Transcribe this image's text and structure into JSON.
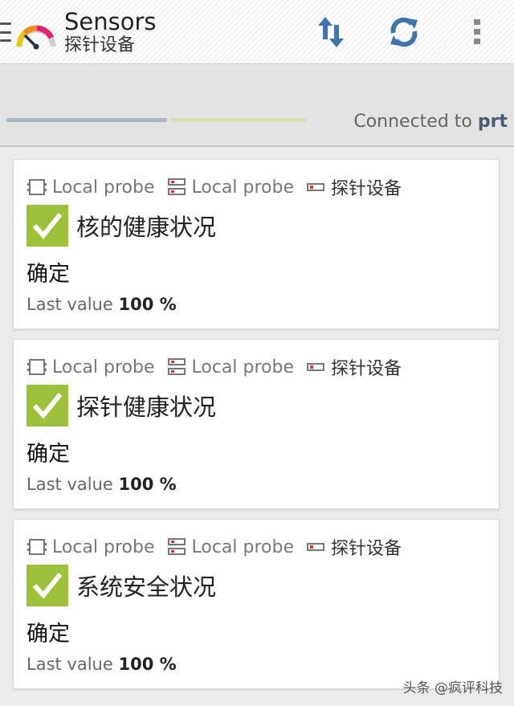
{
  "app": {
    "title": "Sensors",
    "subtitle": "探针设备"
  },
  "toolbar": {
    "icons": [
      "menu-icon",
      "gauge-logo",
      "sort-arrows-icon",
      "refresh-icon",
      "overflow-menu-icon"
    ]
  },
  "status": {
    "connected_label": "Connected to",
    "server": "prt"
  },
  "colors": {
    "ok_green": "#9dc13a",
    "progress_blue": "#a8b6c2",
    "progress_green": "#d8e0b2",
    "server_text": "#4a5a70"
  },
  "cards": [
    {
      "probe": "Local probe",
      "group": "Local probe",
      "device": "探针设备",
      "name": "核的健康状况",
      "status": "确定",
      "last_value_label": "Last value",
      "last_value": "100 %"
    },
    {
      "probe": "Local probe",
      "group": "Local probe",
      "device": "探针设备",
      "name": "探针健康状况",
      "status": "确定",
      "last_value_label": "Last value",
      "last_value": "100 %"
    },
    {
      "probe": "Local probe",
      "group": "Local probe",
      "device": "探针设备",
      "name": "系统安全状况",
      "status": "确定",
      "last_value_label": "Last value",
      "last_value": "100 %"
    }
  ],
  "watermark": "头条 @疯评科技"
}
